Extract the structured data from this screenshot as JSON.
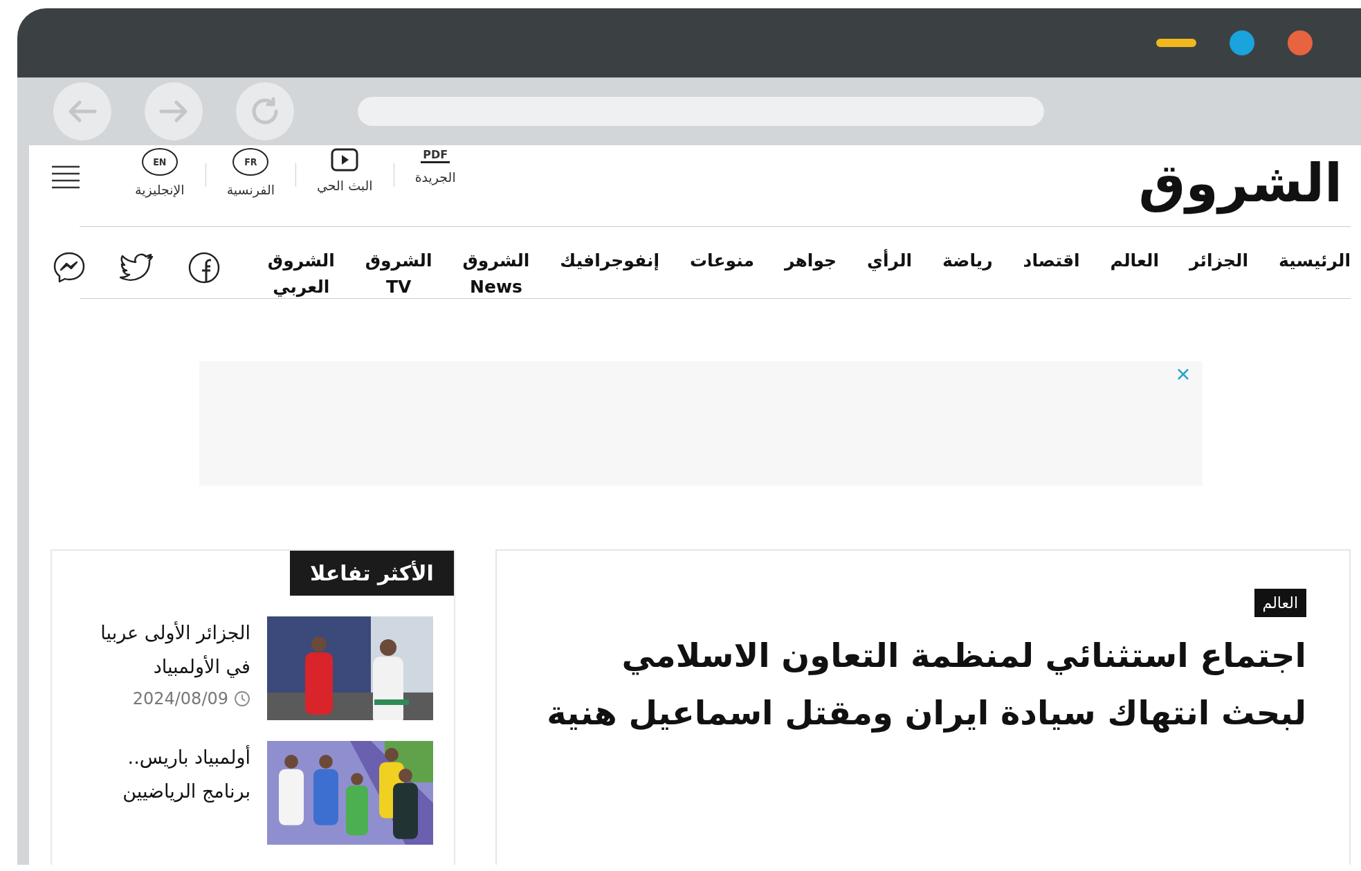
{
  "header": {
    "logo": "الشروق",
    "quick_links": [
      {
        "kind": "pdf",
        "icon_text": "PDF",
        "label": "الجريدة"
      },
      {
        "kind": "live",
        "label": "البث الحي"
      },
      {
        "kind": "lang",
        "icon_text": "FR",
        "label": "الفرنسية"
      },
      {
        "kind": "lang",
        "icon_text": "EN",
        "label": "الإنجليزية"
      }
    ]
  },
  "nav": {
    "items": [
      "الرئيسية",
      "الجزائر",
      "العالم",
      "اقتصاد",
      "رياضة",
      "الرأي",
      "جواهر",
      "منوعات",
      "إنفوجرافيك",
      "الشروق News",
      "الشروق TV",
      "الشروق العربي"
    ],
    "social": [
      {
        "kind": "facebook"
      },
      {
        "kind": "twitter"
      },
      {
        "kind": "messenger"
      }
    ]
  },
  "ad": {
    "closable": true
  },
  "featured": {
    "category": "العالم",
    "headline": "اجتماع استثنائي لمنظمة التعاون الاسلامي لبحث انتهاك سيادة ايران ومقتل اسماعيل هنية"
  },
  "most_interacted": {
    "title": "الأكثر تفاعلا",
    "items": [
      {
        "title": "الجزائر الأولى عربيا في الأولمبياد",
        "date": "2024/08/09",
        "kind": "picture"
      },
      {
        "title": "أولمبياد باريس.. برنامج الرياضيين",
        "kind": "picture"
      }
    ]
  }
}
